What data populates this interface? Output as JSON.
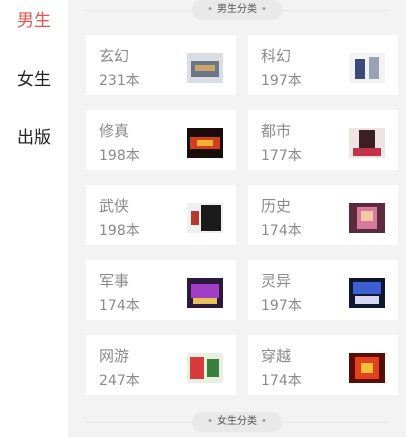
{
  "sidebar": {
    "items": [
      {
        "label": "男生",
        "active": true
      },
      {
        "label": "女生",
        "active": false
      },
      {
        "label": "出版",
        "active": false
      }
    ]
  },
  "sections": [
    {
      "title": "男生分类"
    },
    {
      "title": "女生分类"
    }
  ],
  "categories": [
    {
      "name": "玄幻",
      "count": "231本",
      "cover_colors": [
        "#d9dde4",
        "#6b7785",
        "#c9a46b"
      ]
    },
    {
      "name": "科幻",
      "count": "197本",
      "cover_colors": [
        "#f3f3f3",
        "#3a4a7a",
        "#9aa3b5"
      ]
    },
    {
      "name": "修真",
      "count": "198本",
      "cover_colors": [
        "#1a0c08",
        "#d0401c",
        "#f2b134"
      ]
    },
    {
      "name": "都市",
      "count": "177本",
      "cover_colors": [
        "#efe3e4",
        "#c2324a",
        "#3a1f24"
      ]
    },
    {
      "name": "武侠",
      "count": "198本",
      "cover_colors": [
        "#f0f0ee",
        "#1b1b1b",
        "#b23a2e"
      ]
    },
    {
      "name": "历史",
      "count": "174本",
      "cover_colors": [
        "#5b2a3e",
        "#d77a9b",
        "#f0c9a6"
      ]
    },
    {
      "name": "军事",
      "count": "174本",
      "cover_colors": [
        "#2b1a3d",
        "#a23ec6",
        "#e7c25a"
      ]
    },
    {
      "name": "灵异",
      "count": "197本",
      "cover_colors": [
        "#0f1630",
        "#3e5fd1",
        "#d6d9f0"
      ]
    },
    {
      "name": "网游",
      "count": "247本",
      "cover_colors": [
        "#e8f0e2",
        "#d83a3a",
        "#3a7f3a"
      ]
    },
    {
      "name": "穿越",
      "count": "174本",
      "cover_colors": [
        "#5a0d06",
        "#e6401c",
        "#f4c13a"
      ]
    }
  ],
  "colors": {
    "accent": "#e8534d",
    "panel_bg": "#f3f3f3",
    "card_text": "#8a8a8a"
  }
}
